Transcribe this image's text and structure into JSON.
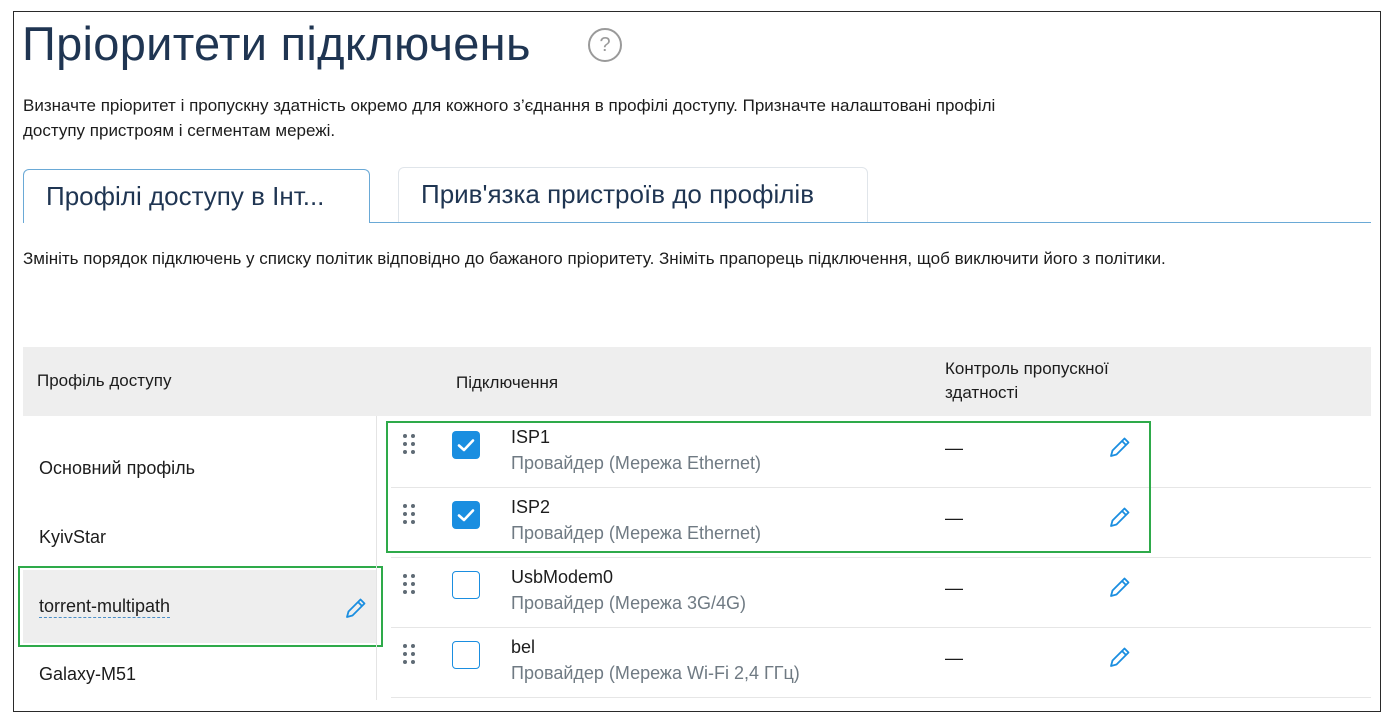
{
  "page": {
    "title": "Пріоритети підключень",
    "help_icon": "?",
    "description_line1": "Визначте пріоритет і пропускну здатність окремо для кожного з’єднання в профілі доступу. Призначте налаштовані профілі",
    "description_line2": "доступу пристроям і сегментам мережі."
  },
  "tabs": [
    {
      "label": "Профілі доступу в Інт...",
      "active": true
    },
    {
      "label": "Прив'язка пристроїв до профілів",
      "active": false
    }
  ],
  "instructions": "Змініть порядок підключень у списку політик відповідно до бажаного пріоритету. Зніміть прапорець підключення, щоб виключити його з політики.",
  "table": {
    "headers": {
      "profile": "Профіль доступу",
      "connection": "Підключення",
      "bandwidth_line1": "Контроль пропускної",
      "bandwidth_line2": "здатності"
    },
    "profiles": [
      {
        "name": "Основний профіль",
        "selected": false
      },
      {
        "name": "KyivStar",
        "selected": false
      },
      {
        "name": "torrent-multipath",
        "selected": true
      },
      {
        "name": "Galaxy-M51",
        "selected": false
      }
    ],
    "connections": [
      {
        "name": "ISP1",
        "type": "Провайдер (Мережа Ethernet)",
        "checked": true,
        "bandwidth": "—"
      },
      {
        "name": "ISP2",
        "type": "Провайдер (Мережа Ethernet)",
        "checked": true,
        "bandwidth": "—"
      },
      {
        "name": "UsbModem0",
        "type": "Провайдер (Мережа 3G/4G)",
        "checked": false,
        "bandwidth": "—"
      },
      {
        "name": "bel",
        "type": "Провайдер (Мережа Wi-Fi 2,4 ГГц)",
        "checked": false,
        "bandwidth": "—"
      }
    ]
  },
  "colors": {
    "accent": "#1a8ee0",
    "highlight_border": "#2eaa4a",
    "title": "#1f3552"
  }
}
